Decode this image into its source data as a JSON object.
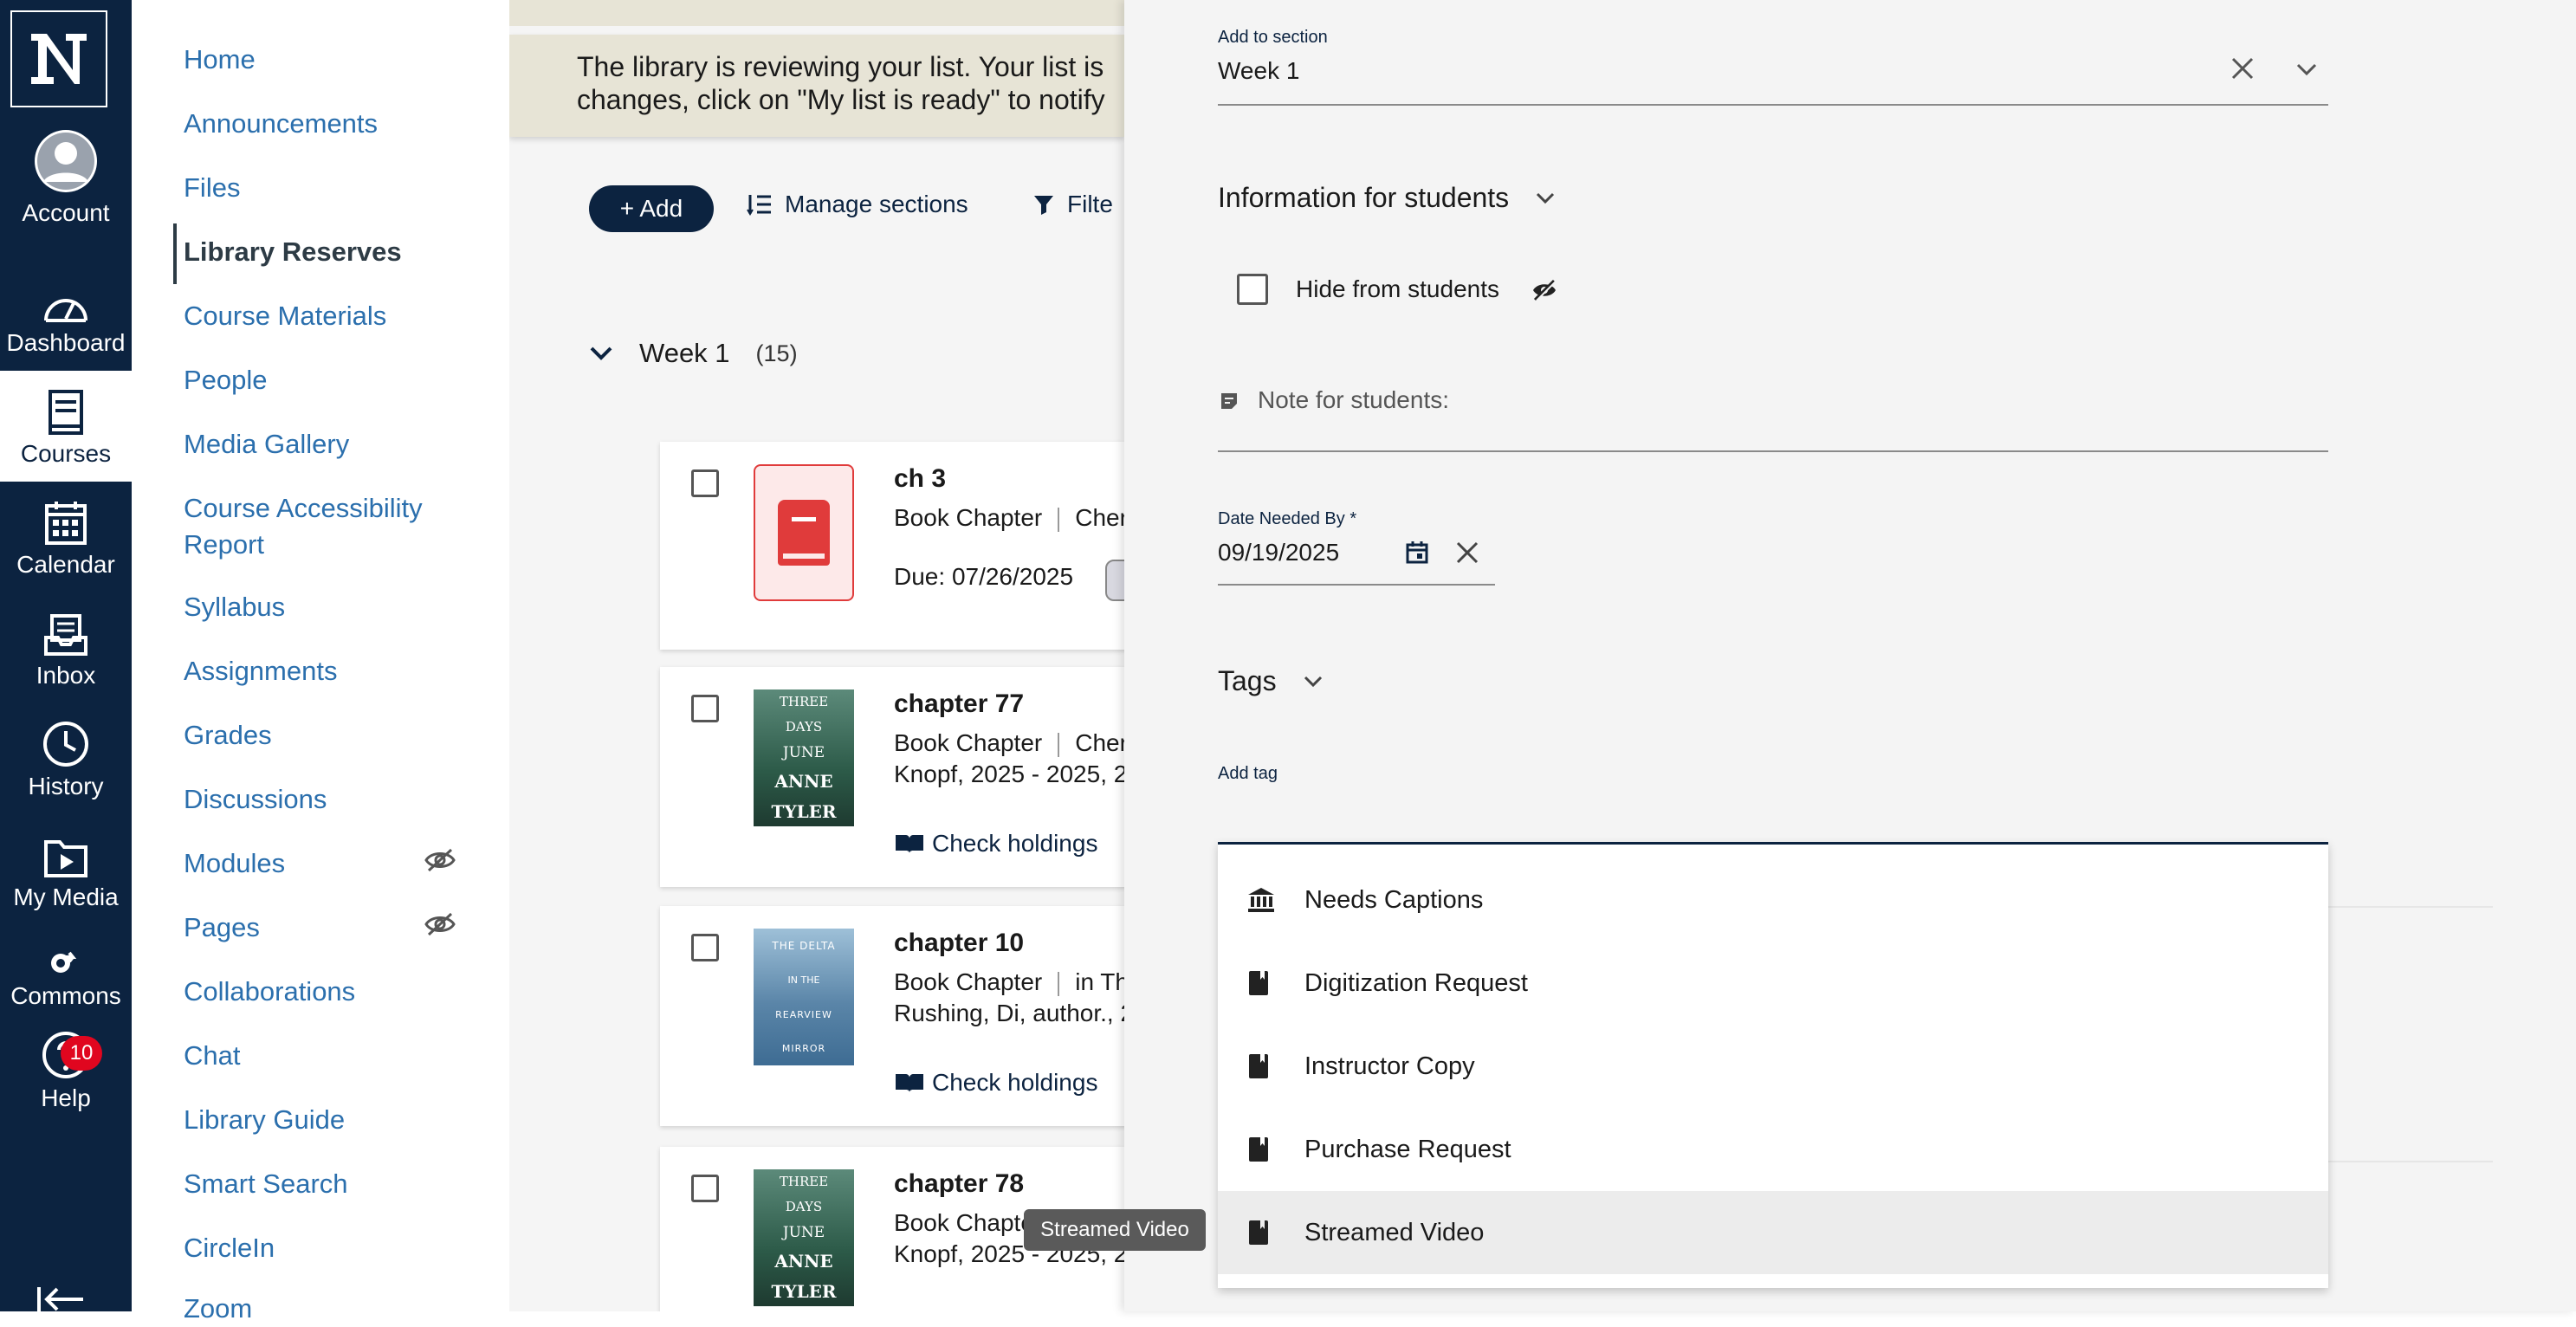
{
  "global_nav": {
    "items": [
      {
        "label": "Account",
        "icon": "account-icon"
      },
      {
        "label": "Dashboard",
        "icon": "dashboard-icon"
      },
      {
        "label": "Courses",
        "icon": "courses-icon",
        "active": true
      },
      {
        "label": "Calendar",
        "icon": "calendar-icon"
      },
      {
        "label": "Inbox",
        "icon": "inbox-icon"
      },
      {
        "label": "History",
        "icon": "history-icon"
      },
      {
        "label": "My Media",
        "icon": "my-media-icon"
      },
      {
        "label": "Commons",
        "icon": "commons-icon"
      },
      {
        "label": "Help",
        "icon": "help-icon"
      }
    ],
    "help_badge": "10",
    "colors": {
      "nav_bg": "#0c2340",
      "badge": "#e0061f"
    }
  },
  "course_nav": {
    "items": [
      "Home",
      "Announcements",
      "Files",
      "Library Reserves",
      "Course Materials",
      "People",
      "Media Gallery",
      "Course Accessibility",
      "Report",
      "Syllabus",
      "Assignments",
      "Grades",
      "Discussions",
      "Modules",
      "Pages",
      "Collaborations",
      "Chat",
      "Library Guide",
      "Smart Search",
      "CircleIn",
      "Zoom"
    ],
    "active": "Library Reserves"
  },
  "banner": {
    "line1": "The library is reviewing your list. Your list is",
    "line2": "changes, click on \"My list is ready\" to notify"
  },
  "toolbar": {
    "add": "+ Add",
    "manage": "Manage sections",
    "filter": "Filte"
  },
  "week": {
    "label": "Week 1",
    "count": "(15)"
  },
  "cards": [
    {
      "title": "ch 3",
      "type": "Book Chapter",
      "extra": "Cher",
      "due_label": "Due:",
      "due_date": "07/26/2025"
    },
    {
      "title": "chapter 77",
      "type": "Book Chapter",
      "extra": "Cher",
      "pub": "Knopf, 2025 - 2025, 2",
      "holdings": "Check holdings",
      "cover_lines": [
        "THREE",
        "DAYS",
        "JUNE",
        "ANNE",
        "TYLER"
      ]
    },
    {
      "title": "chapter 10",
      "type": "Book Chapter",
      "extra": "in Th",
      "pub": "Rushing, Di, author., 2",
      "holdings": "Check holdings",
      "cover_lines": [
        "THE DELTA",
        "IN THE",
        "REARVIEW",
        "MIRROR"
      ]
    },
    {
      "title": "chapter 78",
      "type": "Book Chapte",
      "pub": "Knopf, 2025 - 2025, 2",
      "cover_lines": [
        "THREE",
        "DAYS",
        "JUNE",
        "ANNE",
        "TYLER"
      ]
    }
  ],
  "tooltip": "Streamed Video",
  "panel": {
    "section_label": "Add to section",
    "section_value": "Week 1",
    "info_title": "Information for students",
    "hide_label": "Hide from students",
    "note_placeholder": "Note for students:",
    "date_label": "Date Needed By *",
    "date_value": "09/19/2025",
    "tags_title": "Tags",
    "add_tag_label": "Add tag",
    "options": [
      {
        "label": "Needs Captions",
        "icon": "institution-icon"
      },
      {
        "label": "Digitization Request",
        "icon": "book-icon"
      },
      {
        "label": "Instructor Copy",
        "icon": "book-icon"
      },
      {
        "label": "Purchase Request",
        "icon": "book-icon"
      },
      {
        "label": "Streamed Video",
        "icon": "book-icon",
        "highlighted": true
      }
    ]
  }
}
